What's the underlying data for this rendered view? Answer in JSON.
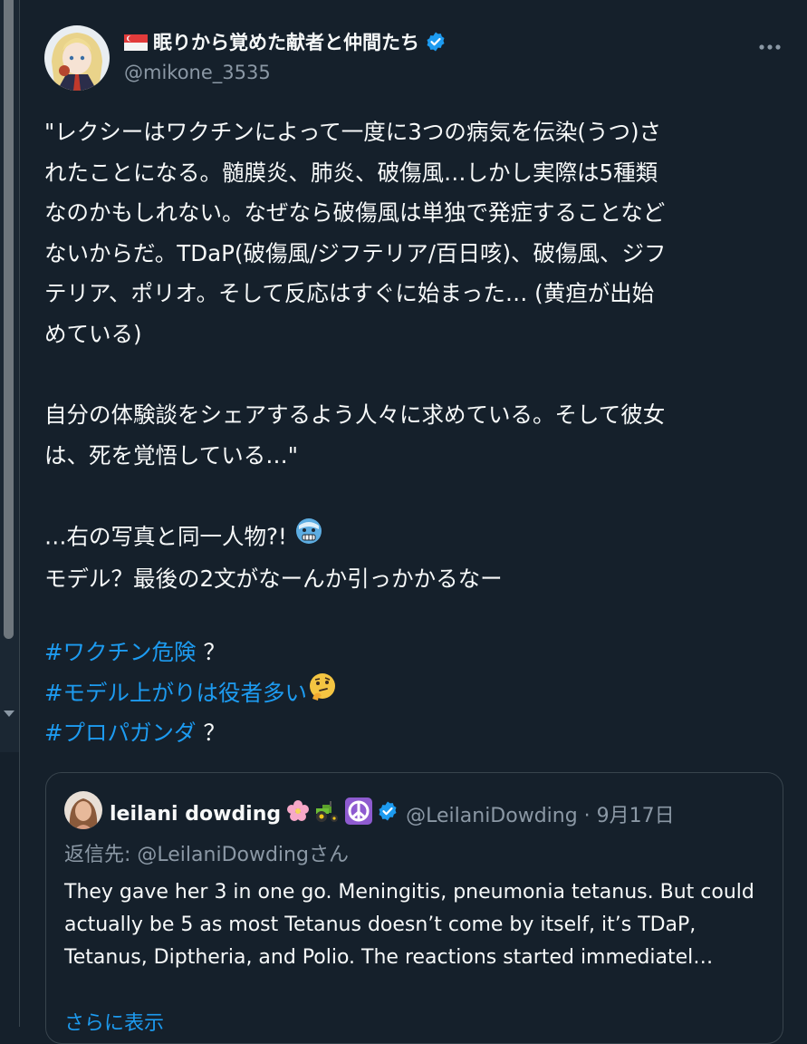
{
  "tweet": {
    "display_name": "眠りから覚めた献者と仲間たち",
    "handle": "@mikone_3535",
    "text": "\"レクシーはワクチンによって一度に3つの病気を伝染(うつ)さ\nれたことになる。髄膜炎、肺炎、破傷風…しかし実際は5種類\nなのかもしれない。なぜなら破傷風は単独で発症することなど\nないからだ。TDaP(破傷風/ジフテリア/百日咳)、破傷風、ジフ\nテリア、ポリオ。そして反応はすぐに始まった… (黄疸が出始\nめている)\n\n自分の体験談をシェアするよう人々に求めている。そして彼女\nは、死を覚悟している…\"\n\n…右の写真と同一人物?!",
    "text_line2": "モデル？最後の2文がなーんか引っかかるなー",
    "hashtags": [
      {
        "tag": "#ワクチン危険",
        "suffix": "？"
      },
      {
        "tag": "#モデル上がりは役者多い",
        "suffix": ""
      },
      {
        "tag": "#プロパガンダ",
        "suffix": "？"
      }
    ],
    "icons": {
      "flag": "singapore-flag-icon",
      "verified": "verified-badge-icon",
      "more": "more-options-icon",
      "emoji_cold": "cold-face-emoji",
      "emoji_thinking": "thinking-face-emoji"
    }
  },
  "quote": {
    "name": "leilani dowding",
    "handle_date": "@LeilaniDowding · 9月17日",
    "replying_to": "返信先: @LeilaniDowdingさん",
    "text": "They gave her 3 in one go.  Meningitis, pneumonia tetanus.  But could actually be 5 as most Tetanus doesn’t come by itself, it’s TDaP, Tetanus, Diptheria, and Polio. The reactions started immediatel…",
    "show_more": "さらに表示",
    "icons": [
      "cherry-blossom-emoji",
      "tractor-emoji",
      "peace-symbol-emoji",
      "verified-badge-icon"
    ]
  },
  "colors": {
    "background": "#15202b",
    "text": "#f7f9f9",
    "secondary": "#8b98a5",
    "link": "#1d9bf0",
    "border": "#38444d"
  }
}
